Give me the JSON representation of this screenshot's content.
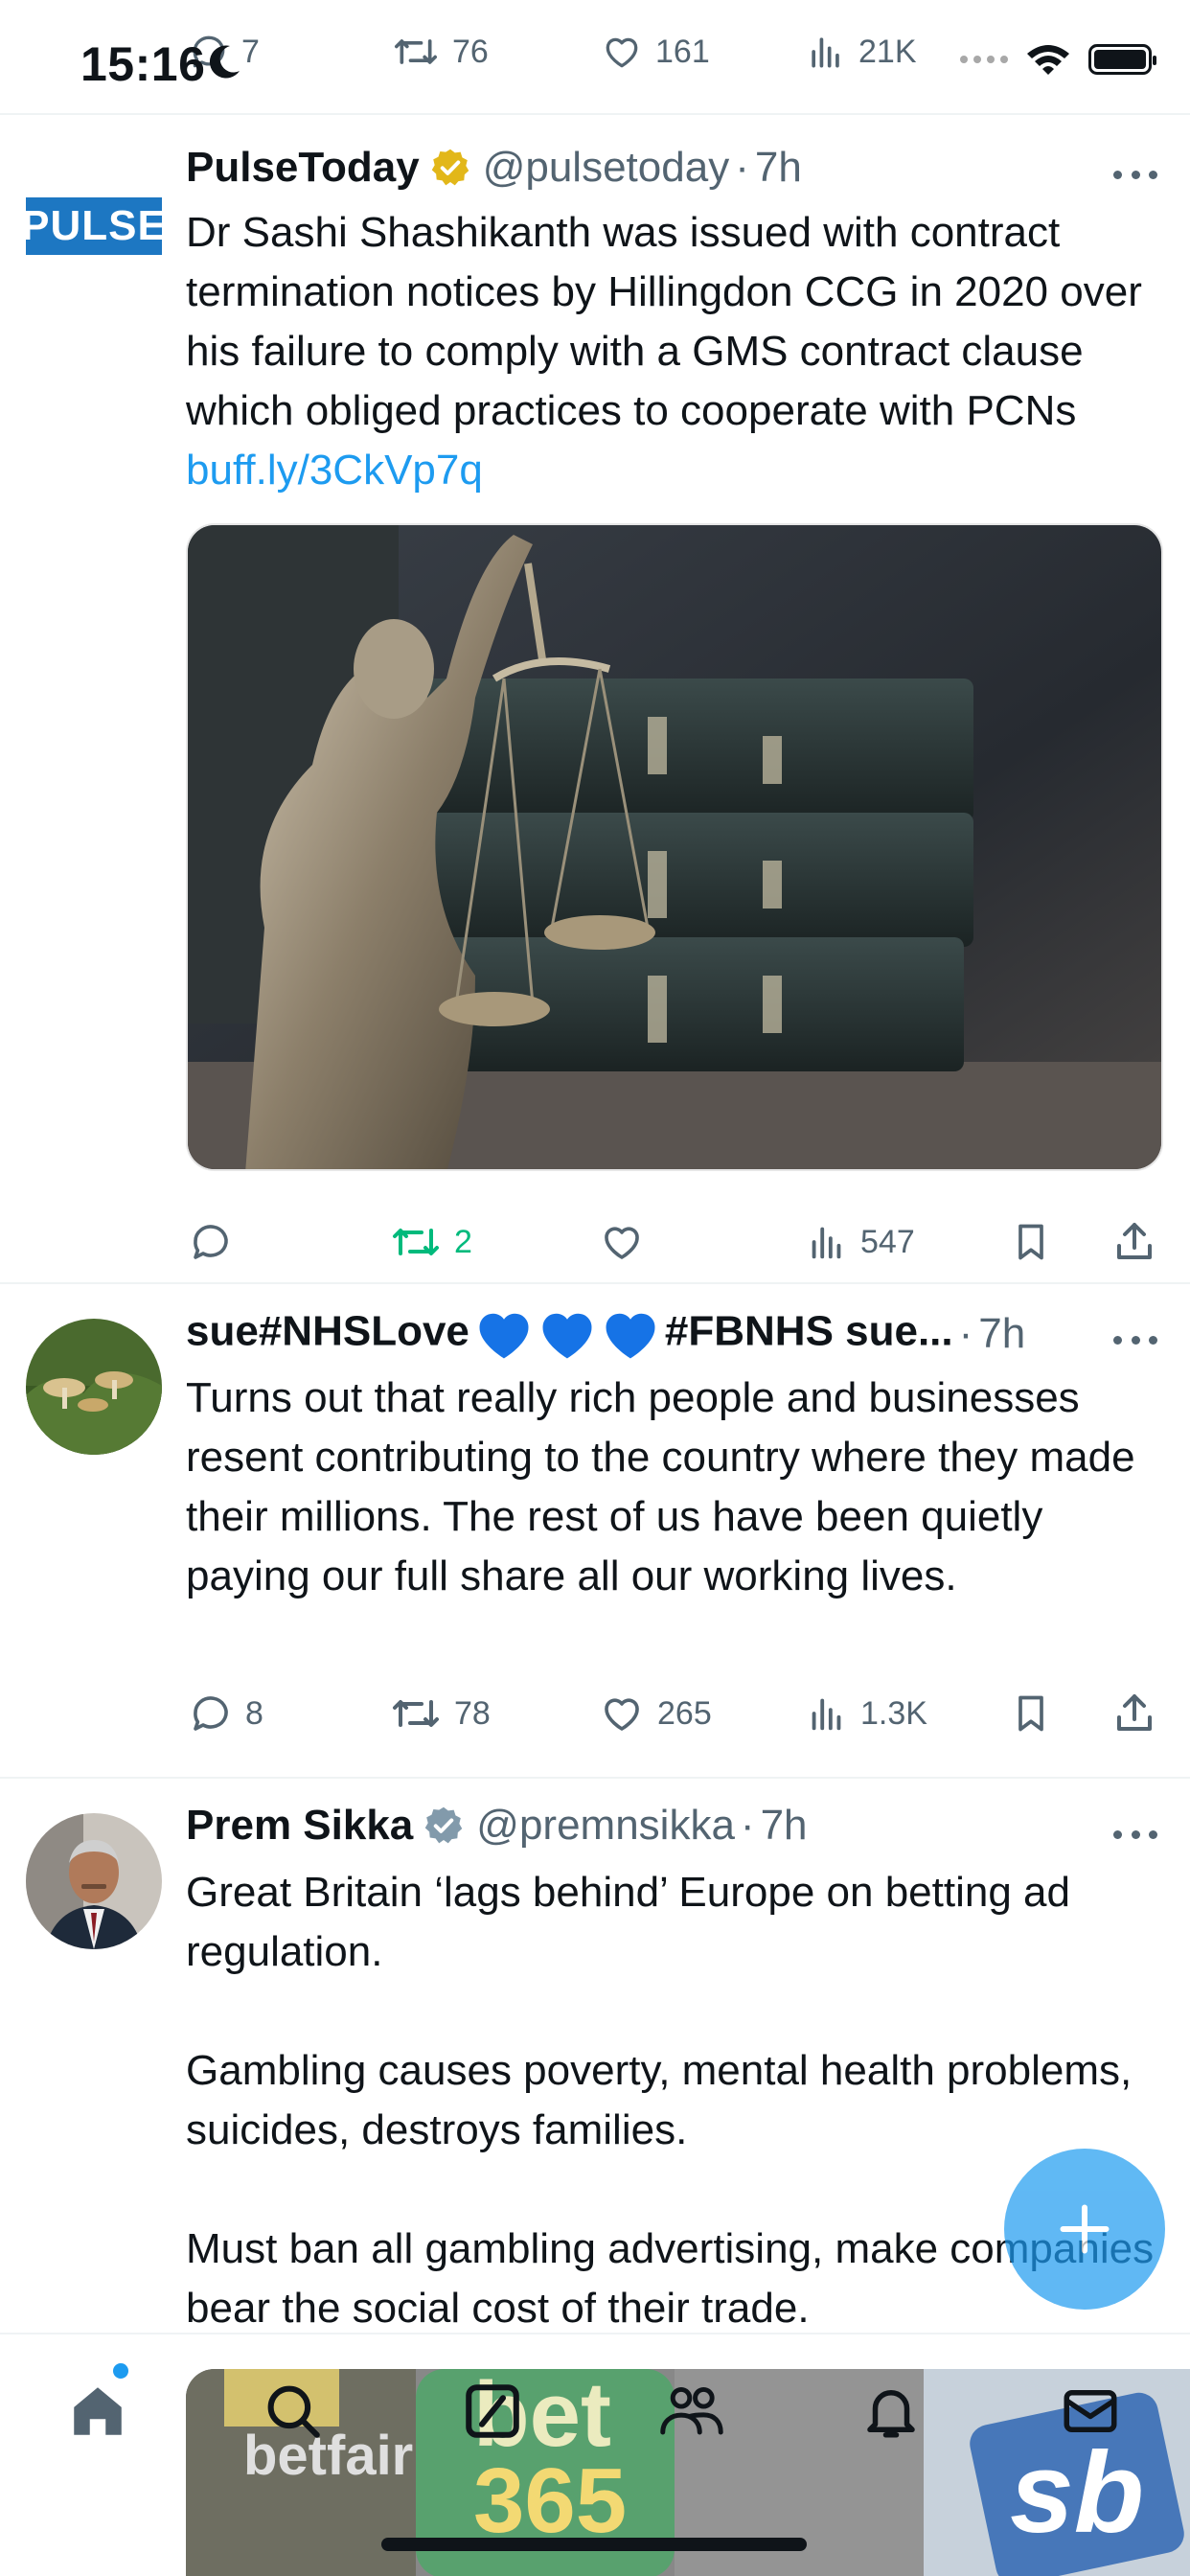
{
  "status_bar": {
    "time": "15:16"
  },
  "previous_tweet_actions": {
    "replies": "7",
    "reposts": "76",
    "likes": "161",
    "views": "21K"
  },
  "tweets": [
    {
      "name": "PulseToday",
      "handle": "@pulsetoday",
      "time": "7h",
      "avatar_text": "PULSE",
      "text": "Dr Sashi Shashikanth was issued with contract termination notices by Hillingdon CCG in 2020 over his failure to comply with a GMS contract clause which obliged practices to cooperate with PCNs ",
      "link": "buff.ly/3CkVp7q",
      "reposts": "2",
      "views": "547"
    },
    {
      "name_a": "sue#NHSLove",
      "name_b": "#FBNHS sue...",
      "time": "7h",
      "text": "Turns out that really rich people and businesses resent contributing to the country where they made their millions.  The rest of us have been quietly paying our full share all our working lives.",
      "replies": "8",
      "reposts": "78",
      "likes": "265",
      "views": "1.3K"
    },
    {
      "name": "Prem Sikka",
      "handle": "@premnsikka",
      "time": "7h",
      "text": "Great Britain ‘lags behind’ Europe on betting ad regulation.\n\nGambling causes poverty, mental health problems, suicides, destroys families.\n\nMust ban all gambling advertising,  make companies bear the social cost of their trade."
    }
  ],
  "media_overlay": {
    "betfair": "betfair",
    "bet365_a": "bet",
    "bet365_b": "365",
    "sb": "sb"
  },
  "colors": {
    "accent": "#1d9bf0",
    "repost_active": "#00ba7c",
    "secondary_text": "#536471",
    "verified_gold": "#e2b719",
    "verified_gray": "#829aab"
  },
  "icons": [
    "comment-icon",
    "repost-icon",
    "heart-icon",
    "views-icon",
    "bookmark-icon",
    "share-icon",
    "home-icon",
    "search-icon",
    "grok-icon",
    "communities-icon",
    "bell-icon",
    "mail-icon",
    "plus-icon"
  ]
}
